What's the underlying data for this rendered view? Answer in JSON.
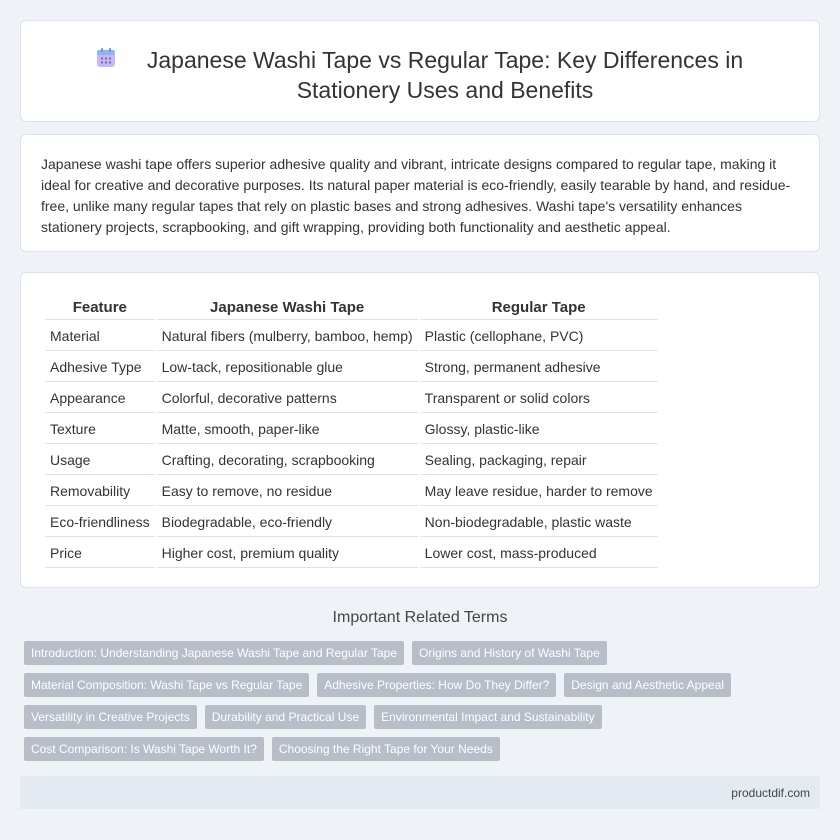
{
  "header": {
    "icon": "calendar-icon",
    "title": "Japanese Washi Tape vs Regular Tape: Key Differences in Stationery Uses and Benefits"
  },
  "summary": "Japanese washi tape offers superior adhesive quality and vibrant, intricate designs compared to regular tape, making it ideal for creative and decorative purposes. Its natural paper material is eco-friendly, easily tearable by hand, and residue-free, unlike many regular tapes that rely on plastic bases and strong adhesives. Washi tape's versatility enhances stationery projects, scrapbooking, and gift wrapping, providing both functionality and aesthetic appeal.",
  "table": {
    "headers": [
      "Feature",
      "Japanese Washi Tape",
      "Regular Tape"
    ],
    "rows": [
      [
        "Material",
        "Natural fibers (mulberry, bamboo, hemp)",
        "Plastic (cellophane, PVC)"
      ],
      [
        "Adhesive Type",
        "Low-tack, repositionable glue",
        "Strong, permanent adhesive"
      ],
      [
        "Appearance",
        "Colorful, decorative patterns",
        "Transparent or solid colors"
      ],
      [
        "Texture",
        "Matte, smooth, paper-like",
        "Glossy, plastic-like"
      ],
      [
        "Usage",
        "Crafting, decorating, scrapbooking",
        "Sealing, packaging, repair"
      ],
      [
        "Removability",
        "Easy to remove, no residue",
        "May leave residue, harder to remove"
      ],
      [
        "Eco-friendliness",
        "Biodegradable, eco-friendly",
        "Non-biodegradable, plastic waste"
      ],
      [
        "Price",
        "Higher cost, premium quality",
        "Lower cost, mass-produced"
      ]
    ]
  },
  "related": {
    "title": "Important Related Terms",
    "tags": [
      [
        "Introduction: Understanding Japanese Washi Tape and Regular Tape",
        "Origins and History of Washi Tape"
      ],
      [
        "Material Composition: Washi Tape vs Regular Tape",
        "Adhesive Properties: How Do They Differ?",
        "Design and Aesthetic Appeal"
      ],
      [
        "Versatility in Creative Projects",
        "Durability and Practical Use",
        "Environmental Impact and Sustainability"
      ],
      [
        "Cost Comparison: Is Washi Tape Worth It?",
        "Choosing the Right Tape for Your Needs"
      ]
    ]
  },
  "footer": {
    "site": "productdif.com"
  },
  "colors": {
    "background": "#eff3f8",
    "tag": "#b7bec8",
    "footer": "#e4eaf2"
  }
}
